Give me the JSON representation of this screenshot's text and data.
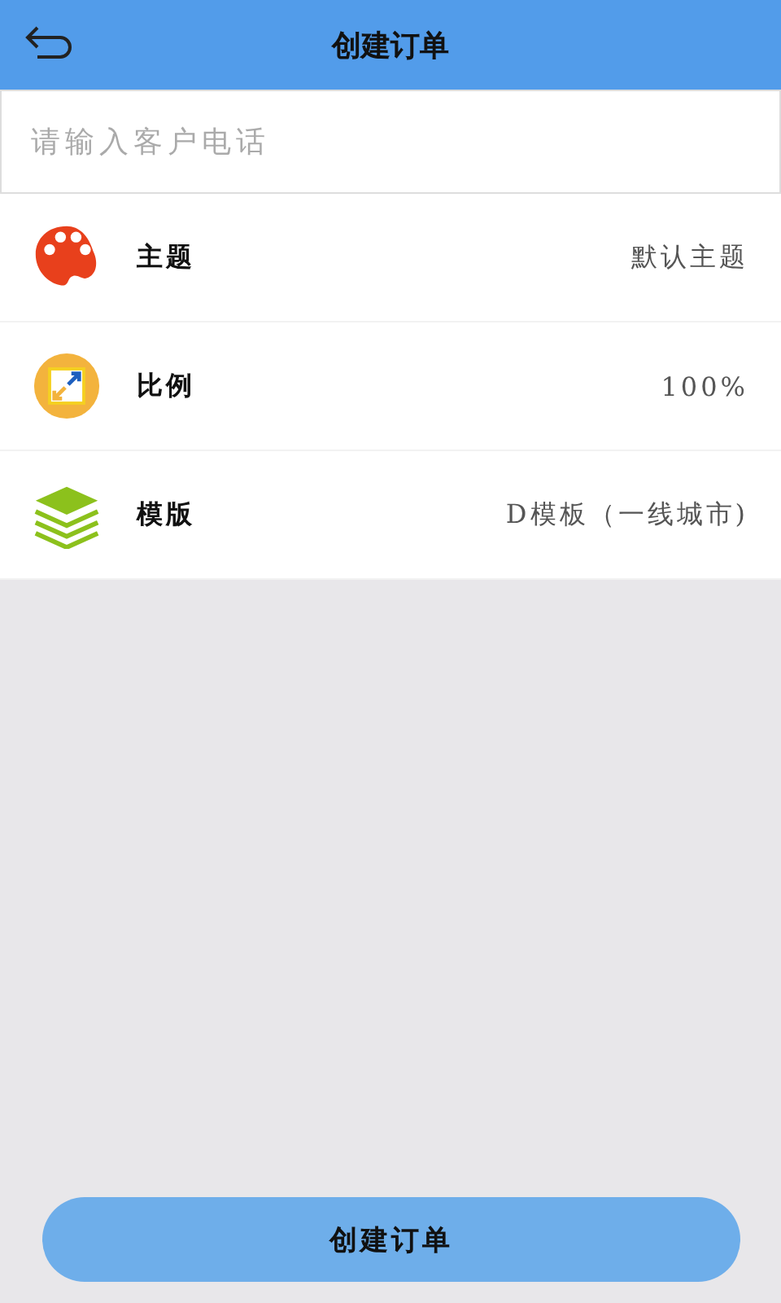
{
  "header": {
    "title": "创建订单"
  },
  "phone_field": {
    "placeholder": "请输入客户电话"
  },
  "settings": [
    {
      "label": "主题",
      "value": "默认主题"
    },
    {
      "label": "比例",
      "value": "100%"
    },
    {
      "label": "模版",
      "value": "D模板（一线城市)"
    }
  ],
  "submit_button": "创建订单"
}
